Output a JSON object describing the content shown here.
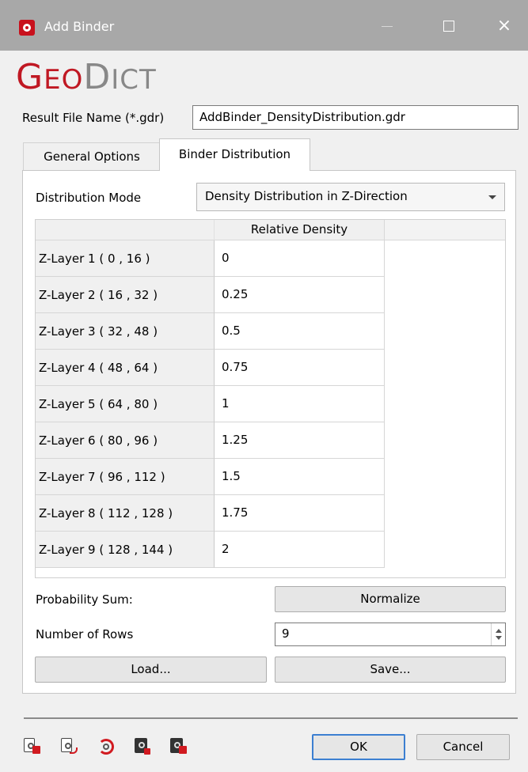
{
  "window": {
    "title": "Add Binder"
  },
  "logo": {
    "part1_big": "G",
    "part1_small": "EO",
    "part2_big": "D",
    "part2_small": "ICT"
  },
  "result_file": {
    "label": "Result File Name (*.gdr)",
    "value": "AddBinder_DensityDistribution.gdr"
  },
  "tabs": [
    {
      "label": "General Options",
      "active": false
    },
    {
      "label": "Binder Distribution",
      "active": true
    }
  ],
  "distribution": {
    "label": "Distribution Mode",
    "selected": "Density Distribution in Z-Direction"
  },
  "table": {
    "column_header": "Relative Density",
    "rows": [
      {
        "header": "Z-Layer 1 ( 0 , 16 )",
        "value": "0"
      },
      {
        "header": "Z-Layer 2 ( 16 , 32 )",
        "value": "0.25"
      },
      {
        "header": "Z-Layer 3 ( 32 , 48 )",
        "value": "0.5"
      },
      {
        "header": "Z-Layer 4 ( 48 , 64 )",
        "value": "0.75"
      },
      {
        "header": "Z-Layer 5 ( 64 , 80 )",
        "value": "1"
      },
      {
        "header": "Z-Layer 6 ( 80 , 96 )",
        "value": "1.25"
      },
      {
        "header": "Z-Layer 7 ( 96 , 112 )",
        "value": "1.5"
      },
      {
        "header": "Z-Layer 8 ( 112 , 128 )",
        "value": "1.75"
      },
      {
        "header": "Z-Layer 9 ( 128 , 144 )",
        "value": "2"
      }
    ]
  },
  "probability": {
    "label": "Probability Sum:",
    "normalize_label": "Normalize"
  },
  "rows_setting": {
    "label": "Number of Rows",
    "value": "9"
  },
  "buttons": {
    "load": "Load...",
    "save": "Save...",
    "ok": "OK",
    "cancel": "Cancel"
  },
  "colors": {
    "brand_red": "#c01823",
    "titlebar": "#a8a8a8",
    "focus_blue": "#3c7fd1"
  },
  "footer_icons": [
    "gear-lock-icon",
    "gear-export-icon",
    "gear-reload-icon",
    "dark-gear-icon",
    "dark-lock-icon"
  ]
}
